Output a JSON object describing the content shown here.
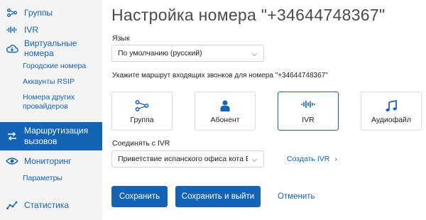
{
  "sidebar": {
    "items": [
      {
        "label": "Группы",
        "icon": "share-icon"
      },
      {
        "label": "IVR",
        "icon": "waveform-icon"
      },
      {
        "label": "Виртуальные номера",
        "icon": "cloud-icon"
      },
      {
        "label": "Маршрутизация вызовов",
        "icon": "routing-icon"
      },
      {
        "label": "Мониторинг",
        "icon": "eye-icon"
      },
      {
        "label": "Статистика",
        "icon": "chart-icon"
      }
    ],
    "subitems_virtual": [
      "Городские номера",
      "Аккаунты RSIP",
      "Номера других провайдеров"
    ],
    "subitems_monitoring": [
      "Параметры"
    ],
    "active_item": "Маршрутизация вызовов"
  },
  "main": {
    "title": "Настройка номера \"+34644748367\"",
    "language_label": "Язык",
    "language_value": "По умолчанию (русский)",
    "route_hint": "Укажите маршрут входящих звонков для номера \"+34644748367\"",
    "route_options": [
      {
        "label": "Группа",
        "icon": "share-icon",
        "selected": false
      },
      {
        "label": "Абонент",
        "icon": "person-icon",
        "selected": false
      },
      {
        "label": "IVR",
        "icon": "waveform-icon",
        "selected": true
      },
      {
        "label": "Аудиофайл",
        "icon": "music-icon",
        "selected": false
      }
    ],
    "connect_label": "Соединять с IVR",
    "connect_value": "Приветствие испанского офиса кота Бублика",
    "create_ivr_link": "Создать IVR",
    "buttons": {
      "save": "Сохранить",
      "save_exit": "Сохранить и выйти",
      "cancel": "Отменить"
    }
  },
  "colors": {
    "accent": "#1463b6",
    "sidebar_bg": "#f3f3f3",
    "border": "#cfd6dd"
  }
}
